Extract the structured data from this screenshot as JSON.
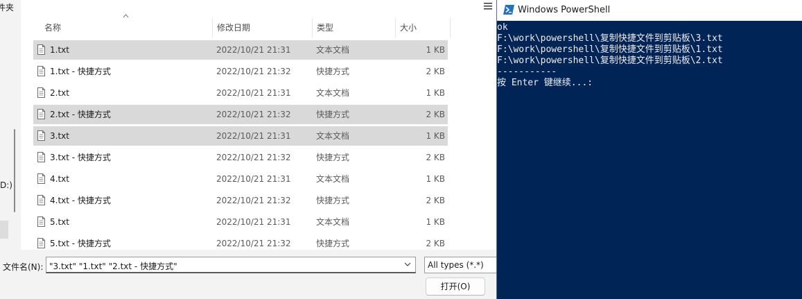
{
  "dialog": {
    "folder_title_fragment": "件夹",
    "drive_label_fragment": "D:)",
    "columns": {
      "name": "名称",
      "date": "修改日期",
      "type": "类型",
      "size": "大小"
    },
    "files": [
      {
        "name": "1.txt",
        "date": "2022/10/21 21:31",
        "type": "文本文档",
        "size": "1 KB",
        "selected": true,
        "shortcut": false
      },
      {
        "name": "1.txt - 快捷方式",
        "date": "2022/10/21 21:32",
        "type": "快捷方式",
        "size": "2 KB",
        "selected": false,
        "shortcut": true
      },
      {
        "name": "2.txt",
        "date": "2022/10/21 21:31",
        "type": "文本文档",
        "size": "1 KB",
        "selected": false,
        "shortcut": false
      },
      {
        "name": "2.txt - 快捷方式",
        "date": "2022/10/21 21:32",
        "type": "快捷方式",
        "size": "2 KB",
        "selected": true,
        "shortcut": true
      },
      {
        "name": "3.txt",
        "date": "2022/10/21 21:31",
        "type": "文本文档",
        "size": "1 KB",
        "selected": true,
        "shortcut": false
      },
      {
        "name": "3.txt - 快捷方式",
        "date": "2022/10/21 21:32",
        "type": "快捷方式",
        "size": "2 KB",
        "selected": false,
        "shortcut": true
      },
      {
        "name": "4.txt",
        "date": "2022/10/21 21:31",
        "type": "文本文档",
        "size": "1 KB",
        "selected": false,
        "shortcut": false
      },
      {
        "name": "4.txt - 快捷方式",
        "date": "2022/10/21 21:32",
        "type": "快捷方式",
        "size": "2 KB",
        "selected": false,
        "shortcut": true
      },
      {
        "name": "5.txt",
        "date": "2022/10/21 21:31",
        "type": "文本文档",
        "size": "1 KB",
        "selected": false,
        "shortcut": false
      },
      {
        "name": "5.txt - 快捷方式",
        "date": "2022/10/21 21:32",
        "type": "快捷方式",
        "size": "2 KB",
        "selected": false,
        "shortcut": true
      }
    ],
    "filename_label": "文件名(N):",
    "filename_value": "\"3.txt\" \"1.txt\" \"2.txt - 快捷方式\"",
    "filetype_value": "All types (*.*)",
    "open_button": "打开(O)"
  },
  "powershell": {
    "title": "Windows PowerShell",
    "lines": [
      "ok",
      "F:\\work\\powershell\\复制快捷文件到剪贴板\\3.txt",
      "F:\\work\\powershell\\复制快捷文件到剪贴板\\1.txt",
      "F:\\work\\powershell\\复制快捷文件到剪贴板\\2.txt",
      "-----------",
      "按 Enter 键继续...:"
    ]
  },
  "colors": {
    "console_bg": "#012456",
    "console_fg": "#eeedf0",
    "selection_bg": "#d9d9d9"
  }
}
